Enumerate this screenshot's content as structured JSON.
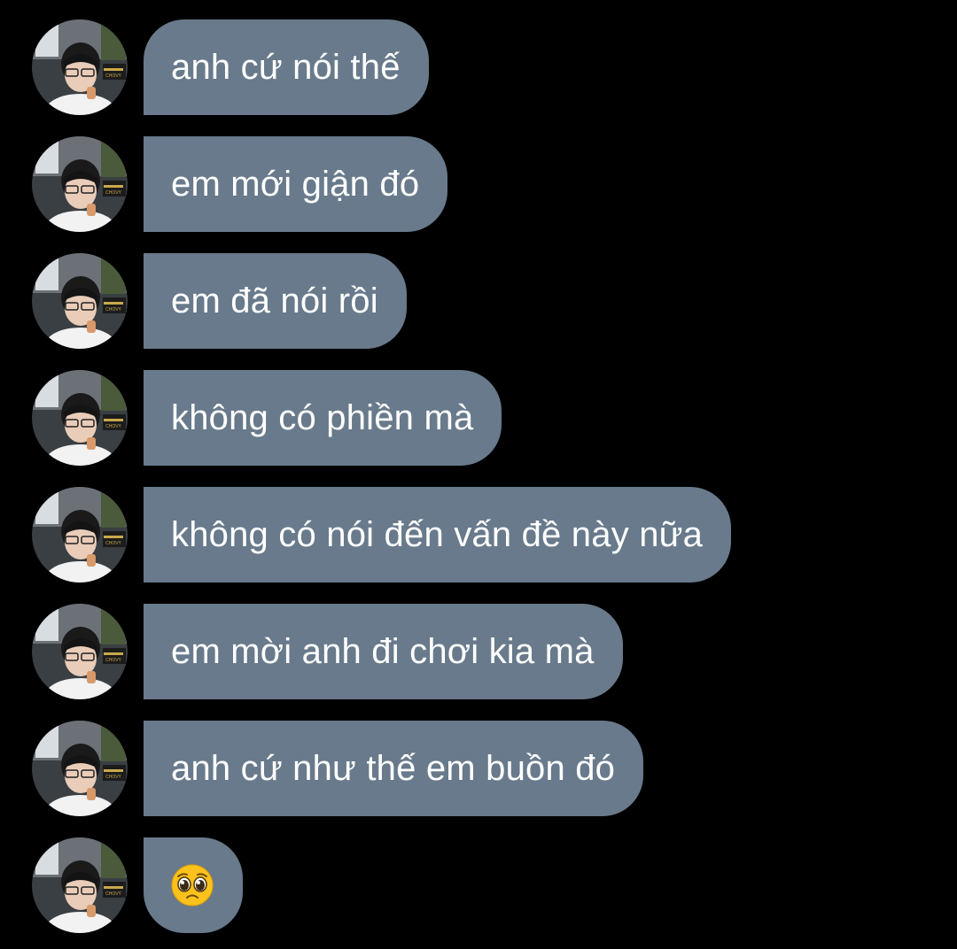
{
  "theme": {
    "background": "#000000",
    "bubble_color": "#687a8b",
    "text_color": "#ffffff"
  },
  "avatar": {
    "icon": "profile-photo-avatar",
    "badge_text": "CHOVY"
  },
  "messages": [
    {
      "text": "anh cứ nói thế"
    },
    {
      "text": "em mới giận đó"
    },
    {
      "text": "em đã nói rồi"
    },
    {
      "text": "không có phiền mà"
    },
    {
      "text": "không có nói đến vấn đề này nữa"
    },
    {
      "text": "em mời anh đi chơi kia mà"
    },
    {
      "text": "anh cứ như thế em buồn đó"
    },
    {
      "emoji": "pleading-face-emoji"
    }
  ]
}
